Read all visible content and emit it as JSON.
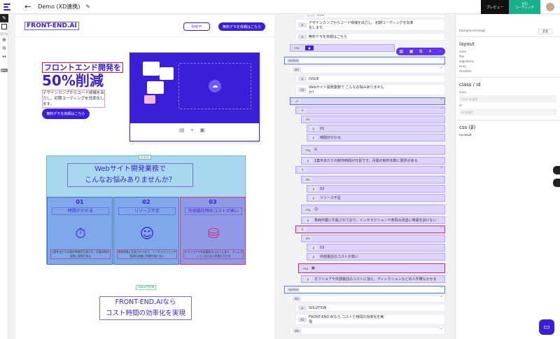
{
  "app": {
    "title": "Demo (XD連携)",
    "preview_label": "プレビュー",
    "code_label": "ゼロ\nコーディング"
  },
  "colors": {
    "brand": "#3b1fd8",
    "accent": "#1bb08c"
  },
  "canvas": {
    "logo": "FRONT-END.AI",
    "login": "Log in",
    "nav_cta": "無料デモを依頼はこちら",
    "hero_title": "フロントエンド開発を",
    "hero_big": "50%削減",
    "hero_sub": "デザインカンプからコード候補を出力し、初期コーディングを効率化します。",
    "hero_cta": "無料デモを依頼はこちら",
    "zoom": "15 %",
    "issue_label": "ISSUE",
    "issue_title": "Webサイト開発業務で\nこんなお悩みありませんか？",
    "columns": [
      {
        "num": "01",
        "title": "時間がかかる",
        "text": "1案件あたりの制作時間が冗長です。月間の制作本数に限界がある",
        "icon": "stopwatch-icon"
      },
      {
        "num": "02",
        "title": "リソース不足",
        "text": "単純作業に忙殺されており、インタラクションや表現の改善に時間を割けない",
        "icon": "team-icon"
      },
      {
        "num": "03",
        "title": "外部委託時のコストが高い",
        "text": "オフショアや外部委託のコストに加え、ディレクションなどの人件費もかかる",
        "icon": "coins-icon"
      }
    ],
    "solution_label": "SOLUTION",
    "solution_title": "FRONT-END.AIなら\nコスト時間の効率化を実現"
  },
  "tree": {
    "rows": [
      {
        "tag": "",
        "text": "削減"
      },
      {
        "tag": "p",
        "text": "デザインカンプからコード候補を出力し、初期コーディングを効率化します。"
      },
      {
        "tag": "a",
        "text": "無料デモを依頼はこちら"
      },
      {
        "tag": "img",
        "text": ""
      },
      {
        "tag": "section",
        "text": ""
      },
      {
        "tag": "div",
        "text": ""
      },
      {
        "tag": "p",
        "text": "ISSUE"
      },
      {
        "tag": "h2",
        "text": "Webサイト開発業務で こんなお悩みありませんか？"
      },
      {
        "tag": "ul",
        "text": ""
      },
      {
        "tag": "li",
        "text": ""
      },
      {
        "tag": "div",
        "text": ""
      },
      {
        "tag": "p",
        "text": "01"
      },
      {
        "tag": "p",
        "text": "時間がかかる"
      },
      {
        "tag": "img",
        "text": ""
      },
      {
        "tag": "p",
        "text": "1案件あたりの制作時間が冗長です。月間の制作本数に限界がある"
      },
      {
        "tag": "li",
        "text": ""
      },
      {
        "tag": "div",
        "text": ""
      },
      {
        "tag": "p",
        "text": "02"
      },
      {
        "tag": "p",
        "text": "リソース不足"
      },
      {
        "tag": "img",
        "text": ""
      },
      {
        "tag": "p",
        "text": "単純作業に忙殺されており、インタラクションや表現の改善に時間を割けない"
      },
      {
        "tag": "li",
        "text": ""
      },
      {
        "tag": "div",
        "text": ""
      },
      {
        "tag": "p",
        "text": "03"
      },
      {
        "tag": "p",
        "text": "外部委託のコストが高い"
      },
      {
        "tag": "img",
        "text": ""
      },
      {
        "tag": "p",
        "text": "オフショアや外部委託のコストに加え、ディレクションなどの人件費もかかる"
      },
      {
        "tag": "section",
        "text": ""
      },
      {
        "tag": "div",
        "text": ""
      },
      {
        "tag": "p",
        "text": "SOLUTION"
      },
      {
        "tag": "h2",
        "text": "FRONT-END.AIなら コストと時間の効率化を実現"
      },
      {
        "tag": "div",
        "text": ""
      }
    ]
  },
  "props": {
    "bg_label": "background-image",
    "set_btn": "変更",
    "layout": "layout",
    "class_section": "class / id",
    "class_label": "class",
    "class_placeholder": "class を追加",
    "id_label": "id",
    "id_placeholder": "id を指定",
    "css_title": "css (β)",
    "css_result": "no result",
    "layout_labels": [
      "class",
      "flex",
      "alignItems",
      "wrap",
      "direction"
    ]
  }
}
